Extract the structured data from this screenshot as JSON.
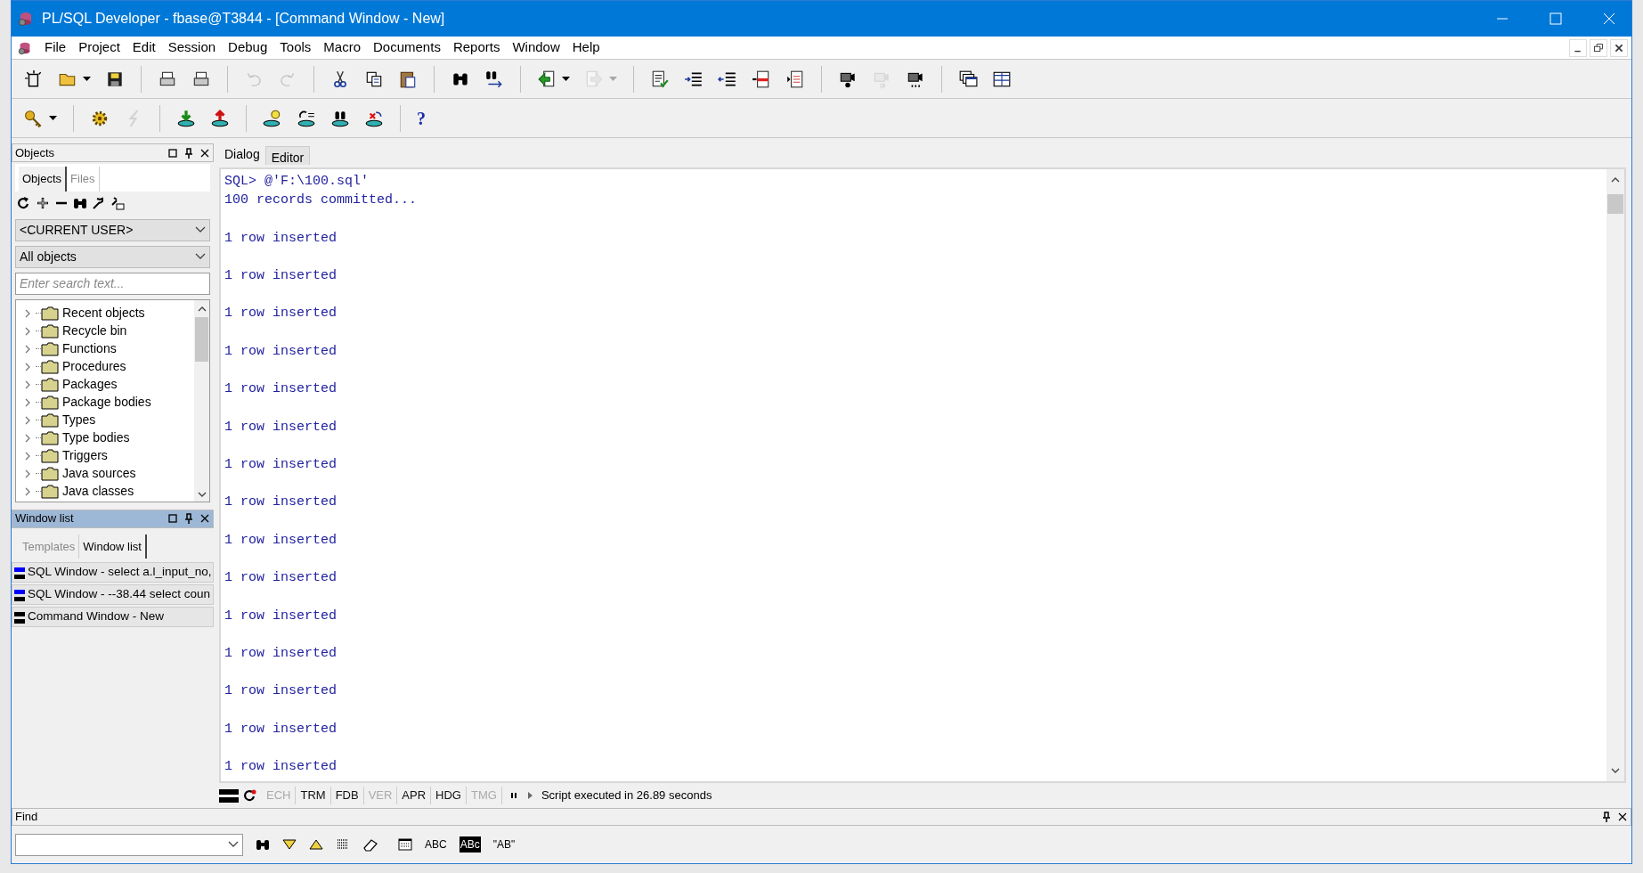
{
  "window": {
    "title": "PL/SQL Developer - fbase@T3844 - [Command Window - New]"
  },
  "menu": [
    "File",
    "Project",
    "Edit",
    "Session",
    "Debug",
    "Tools",
    "Macro",
    "Documents",
    "Reports",
    "Window",
    "Help"
  ],
  "toolbar_1": [
    {
      "disabled": false
    },
    {
      "disabled": false
    },
    {
      "disabled": false
    },
    {
      "disabled": false
    },
    {
      "disabled": false
    },
    {
      "disabled": true
    },
    {
      "disabled": true
    },
    {
      "disabled": false
    },
    {
      "disabled": false
    },
    {
      "disabled": false
    },
    {
      "disabled": false
    },
    {
      "disabled": false
    },
    {
      "disabled": false
    },
    {
      "disabled": true
    },
    {
      "disabled": false
    },
    {
      "disabled": false
    },
    {
      "disabled": false
    },
    {
      "disabled": false
    },
    {
      "disabled": false
    },
    {
      "disabled": false
    },
    {
      "disabled": true
    },
    {
      "disabled": false
    },
    {
      "disabled": false
    },
    {
      "disabled": false
    }
  ],
  "toolbar_2": [
    {
      "disabled": false
    },
    {
      "disabled": false
    },
    {
      "disabled": true
    },
    {
      "disabled": false
    },
    {
      "disabled": false
    },
    {
      "disabled": false
    },
    {
      "disabled": false
    },
    {
      "disabled": false
    },
    {
      "disabled": false
    }
  ],
  "help_button": "?",
  "objects_panel": {
    "title": "Objects",
    "tabs": [
      {
        "label": "Objects",
        "selected": true
      },
      {
        "label": "Files",
        "selected": false
      }
    ],
    "user_dropdown": "<CURRENT USER>",
    "filter_dropdown": "All objects",
    "search": {
      "placeholder": "Enter search text..."
    },
    "tree": [
      {
        "label": "Recent objects",
        "expanded": false
      },
      {
        "label": "Recycle bin",
        "expanded": false
      },
      {
        "label": "Functions",
        "expanded": false
      },
      {
        "label": "Procedures",
        "expanded": false
      },
      {
        "label": "Packages",
        "expanded": false
      },
      {
        "label": "Package bodies",
        "expanded": false
      },
      {
        "label": "Types",
        "expanded": false
      },
      {
        "label": "Type bodies",
        "expanded": false
      },
      {
        "label": "Triggers",
        "expanded": false
      },
      {
        "label": "Java sources",
        "expanded": false
      },
      {
        "label": "Java classes",
        "expanded": false
      }
    ]
  },
  "window_list_panel": {
    "title": "Window list",
    "tabs": [
      {
        "label": "Templates",
        "selected": false
      },
      {
        "label": "Window list",
        "selected": true
      }
    ],
    "items": [
      {
        "label": "SQL Window - select a.l_input_no,",
        "kind": "sql"
      },
      {
        "label": "SQL Window - --38.44 select coun",
        "kind": "sql"
      },
      {
        "label": "Command Window - New",
        "kind": "command"
      }
    ]
  },
  "editor_tabs": [
    {
      "label": "Dialog",
      "selected": true
    },
    {
      "label": "Editor",
      "selected": false
    }
  ],
  "output": [
    {
      "kind": "command",
      "text": "SQL> @'F:\\100.sql'"
    },
    {
      "kind": "message",
      "text": "100 records committed..."
    },
    {
      "kind": "result",
      "text": "1 row inserted"
    },
    {
      "kind": "result",
      "text": "1 row inserted"
    },
    {
      "kind": "result",
      "text": "1 row inserted"
    },
    {
      "kind": "result",
      "text": "1 row inserted"
    },
    {
      "kind": "result",
      "text": "1 row inserted"
    },
    {
      "kind": "result",
      "text": "1 row inserted"
    },
    {
      "kind": "result",
      "text": "1 row inserted"
    },
    {
      "kind": "result",
      "text": "1 row inserted"
    },
    {
      "kind": "result",
      "text": "1 row inserted"
    },
    {
      "kind": "result",
      "text": "1 row inserted"
    },
    {
      "kind": "result",
      "text": "1 row inserted"
    },
    {
      "kind": "result",
      "text": "1 row inserted"
    },
    {
      "kind": "result",
      "text": "1 row inserted"
    },
    {
      "kind": "result",
      "text": "1 row inserted"
    },
    {
      "kind": "result",
      "text": "1 row inserted"
    }
  ],
  "status_flags": [
    {
      "label": "ECH",
      "disabled": true
    },
    {
      "label": "TRM",
      "disabled": false
    },
    {
      "label": "FDB",
      "disabled": false
    },
    {
      "label": "VER",
      "disabled": true
    },
    {
      "label": "APR",
      "disabled": false
    },
    {
      "label": "HDG",
      "disabled": false
    },
    {
      "label": "TMG",
      "disabled": true
    }
  ],
  "status_message": "Script executed in 26.89 seconds",
  "find_panel": {
    "title": "Find",
    "options": [
      {
        "label": "ABC",
        "kind": "plain"
      },
      {
        "label": "ABc",
        "kind": "inverted"
      },
      {
        "label": "\"AB\"",
        "kind": "plain"
      }
    ]
  }
}
